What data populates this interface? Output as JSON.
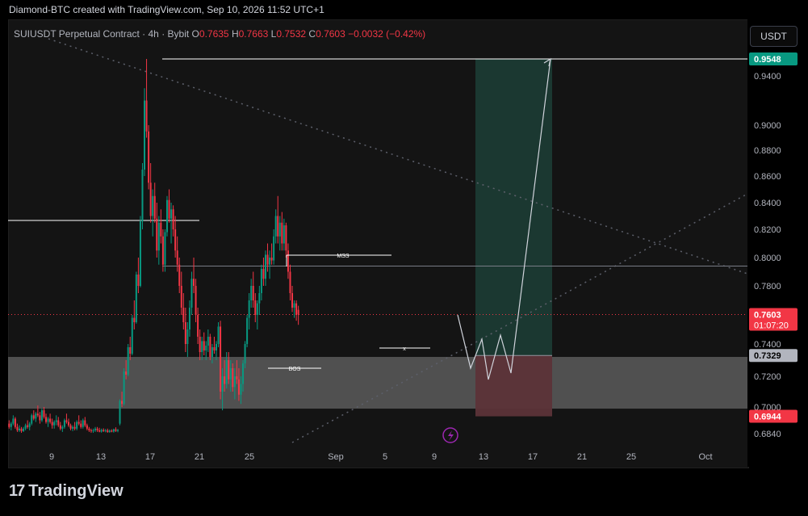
{
  "header": {
    "text": "Diamond-BTC created with TradingView.com, Sep 10, 2026 11:52 UTC+1"
  },
  "legend": {
    "symbol": "SUIUSDT Perpetual Contract · 4h · Bybit",
    "o_label": "O",
    "o": "0.7635",
    "h_label": "H",
    "h": "0.7663",
    "l_label": "L",
    "l": "0.7532",
    "c_label": "C",
    "c": "0.7603",
    "change": "−0.0032 (−0.42%)"
  },
  "currency_button": "USDT",
  "brand": {
    "name": "TradingView",
    "logo_mark": "17"
  },
  "chart_data": {
    "type": "candlestick",
    "x_tick_labels": [
      "9",
      "13",
      "17",
      "21",
      "25",
      "Sep",
      "5",
      "9",
      "13",
      "17",
      "21",
      "25",
      "Oct"
    ],
    "y_tick_labels": [
      "0.9400",
      "0.9000",
      "0.8800",
      "0.8600",
      "0.8400",
      "0.8200",
      "0.8000",
      "0.7800",
      "0.7400",
      "0.7200",
      "0.7000",
      "0.6840"
    ],
    "price_tags": [
      {
        "value": "0.9548",
        "color": "#089981",
        "text_color": "#ffffff"
      },
      {
        "value": "0.7603",
        "color": "#f23645",
        "text_color": "#ffffff",
        "countdown": "01:07:20"
      },
      {
        "value": "0.7329",
        "color": "#b2b5be",
        "text_color": "#000000"
      },
      {
        "value": "0.6944",
        "color": "#f23645",
        "text_color": "#ffffff"
      }
    ],
    "annotations": [
      "MSS",
      "BOS",
      "x"
    ],
    "position": {
      "type": "long",
      "target": 0.9548,
      "entry": 0.7329,
      "stop": 0.6944
    },
    "demand_zone": [
      0.699,
      0.732
    ],
    "resistance_levels": [
      0.9548,
      0.794
    ],
    "colors": {
      "up": "#089981",
      "down": "#f23645",
      "profit_zone": "#1b3a33",
      "loss_zone": "#5c3338",
      "demand_zone": "#5a5a5a"
    },
    "candles": [
      [
        0.69,
        0.692,
        0.687,
        0.688
      ],
      [
        0.688,
        0.691,
        0.686,
        0.69
      ],
      [
        0.69,
        0.695,
        0.689,
        0.693
      ],
      [
        0.693,
        0.694,
        0.687,
        0.688
      ],
      [
        0.688,
        0.69,
        0.685,
        0.686
      ],
      [
        0.686,
        0.689,
        0.685,
        0.687
      ],
      [
        0.687,
        0.688,
        0.6845,
        0.6855
      ],
      [
        0.6855,
        0.688,
        0.685,
        0.687
      ],
      [
        0.687,
        0.69,
        0.686,
        0.689
      ],
      [
        0.689,
        0.692,
        0.687,
        0.688
      ],
      [
        0.688,
        0.691,
        0.686,
        0.69
      ],
      [
        0.69,
        0.696,
        0.689,
        0.695
      ],
      [
        0.695,
        0.698,
        0.692,
        0.693
      ],
      [
        0.693,
        0.697,
        0.691,
        0.696
      ],
      [
        0.696,
        0.701,
        0.694,
        0.695
      ],
      [
        0.695,
        0.697,
        0.69,
        0.692
      ],
      [
        0.692,
        0.699,
        0.691,
        0.698
      ],
      [
        0.698,
        0.7,
        0.693,
        0.694
      ],
      [
        0.694,
        0.696,
        0.69,
        0.691
      ],
      [
        0.691,
        0.694,
        0.688,
        0.693
      ],
      [
        0.693,
        0.696,
        0.69,
        0.691
      ],
      [
        0.691,
        0.693,
        0.687,
        0.689
      ],
      [
        0.689,
        0.692,
        0.687,
        0.691
      ],
      [
        0.691,
        0.695,
        0.689,
        0.692
      ],
      [
        0.692,
        0.694,
        0.688,
        0.689
      ],
      [
        0.689,
        0.691,
        0.686,
        0.687
      ],
      [
        0.687,
        0.689,
        0.685,
        0.688
      ],
      [
        0.688,
        0.693,
        0.687,
        0.692
      ],
      [
        0.692,
        0.696,
        0.69,
        0.691
      ],
      [
        0.691,
        0.693,
        0.688,
        0.689
      ],
      [
        0.689,
        0.69,
        0.686,
        0.687
      ],
      [
        0.687,
        0.689,
        0.6855,
        0.688
      ],
      [
        0.688,
        0.691,
        0.686,
        0.687
      ],
      [
        0.687,
        0.692,
        0.686,
        0.691
      ],
      [
        0.691,
        0.695,
        0.689,
        0.69
      ],
      [
        0.69,
        0.692,
        0.687,
        0.688
      ],
      [
        0.688,
        0.693,
        0.687,
        0.692
      ],
      [
        0.692,
        0.694,
        0.688,
        0.689
      ],
      [
        0.689,
        0.69,
        0.686,
        0.687
      ],
      [
        0.687,
        0.688,
        0.685,
        0.686
      ],
      [
        0.686,
        0.687,
        0.6845,
        0.6855
      ],
      [
        0.6855,
        0.687,
        0.6845,
        0.686
      ],
      [
        0.686,
        0.688,
        0.685,
        0.687
      ],
      [
        0.687,
        0.688,
        0.685,
        0.686
      ],
      [
        0.686,
        0.6875,
        0.6848,
        0.6852
      ],
      [
        0.6852,
        0.687,
        0.6846,
        0.6862
      ],
      [
        0.6862,
        0.6872,
        0.685,
        0.6855
      ],
      [
        0.6855,
        0.6868,
        0.6848,
        0.686
      ],
      [
        0.686,
        0.687,
        0.6845,
        0.685
      ],
      [
        0.685,
        0.6865,
        0.6845,
        0.6858
      ],
      [
        0.6858,
        0.6866,
        0.6848,
        0.6852
      ],
      [
        0.6852,
        0.687,
        0.6846,
        0.6866
      ],
      [
        0.6866,
        0.6878,
        0.685,
        0.6856
      ],
      [
        0.6856,
        0.6868,
        0.6848,
        0.6862
      ],
      [
        0.69,
        0.705,
        0.689,
        0.704
      ],
      [
        0.704,
        0.71,
        0.7,
        0.702
      ],
      [
        0.702,
        0.725,
        0.701,
        0.723
      ],
      [
        0.723,
        0.73,
        0.718,
        0.721
      ],
      [
        0.721,
        0.74,
        0.72,
        0.738
      ],
      [
        0.738,
        0.745,
        0.73,
        0.734
      ],
      [
        0.734,
        0.76,
        0.733,
        0.758
      ],
      [
        0.758,
        0.77,
        0.75,
        0.755
      ],
      [
        0.755,
        0.79,
        0.754,
        0.788
      ],
      [
        0.788,
        0.8,
        0.775,
        0.78
      ],
      [
        0.78,
        0.83,
        0.779,
        0.826
      ],
      [
        0.826,
        0.87,
        0.82,
        0.865
      ],
      [
        0.865,
        0.93,
        0.86,
        0.92
      ],
      [
        0.92,
        0.9548,
        0.89,
        0.895
      ],
      [
        0.895,
        0.9,
        0.85,
        0.855
      ],
      [
        0.855,
        0.87,
        0.825,
        0.83
      ],
      [
        0.83,
        0.85,
        0.815,
        0.845
      ],
      [
        0.845,
        0.855,
        0.825,
        0.828
      ],
      [
        0.828,
        0.84,
        0.8,
        0.805
      ],
      [
        0.805,
        0.83,
        0.795,
        0.825
      ],
      [
        0.825,
        0.835,
        0.81,
        0.815
      ],
      [
        0.815,
        0.82,
        0.79,
        0.795
      ],
      [
        0.795,
        0.82,
        0.79,
        0.818
      ],
      [
        0.818,
        0.845,
        0.815,
        0.842
      ],
      [
        0.842,
        0.85,
        0.825,
        0.828
      ],
      [
        0.828,
        0.84,
        0.81,
        0.835
      ],
      [
        0.835,
        0.838,
        0.815,
        0.82
      ],
      [
        0.82,
        0.83,
        0.8,
        0.805
      ],
      [
        0.805,
        0.815,
        0.79,
        0.795
      ],
      [
        0.795,
        0.8,
        0.775,
        0.78
      ],
      [
        0.78,
        0.79,
        0.76,
        0.765
      ],
      [
        0.765,
        0.775,
        0.75,
        0.755
      ],
      [
        0.755,
        0.765,
        0.735,
        0.74
      ],
      [
        0.74,
        0.755,
        0.732,
        0.75
      ],
      [
        0.75,
        0.77,
        0.745,
        0.765
      ],
      [
        0.765,
        0.79,
        0.76,
        0.785
      ],
      [
        0.785,
        0.8,
        0.775,
        0.78
      ],
      [
        0.78,
        0.785,
        0.755,
        0.76
      ],
      [
        0.76,
        0.765,
        0.74,
        0.745
      ],
      [
        0.745,
        0.75,
        0.73,
        0.735
      ],
      [
        0.735,
        0.745,
        0.73,
        0.742
      ],
      [
        0.742,
        0.748,
        0.733,
        0.736
      ],
      [
        0.736,
        0.742,
        0.73,
        0.739
      ],
      [
        0.739,
        0.75,
        0.735,
        0.745
      ],
      [
        0.745,
        0.747,
        0.73,
        0.732
      ],
      [
        0.732,
        0.74,
        0.728,
        0.738
      ],
      [
        0.738,
        0.745,
        0.734,
        0.736
      ],
      [
        0.736,
        0.742,
        0.73,
        0.74
      ],
      [
        0.74,
        0.755,
        0.738,
        0.752
      ],
      [
        0.752,
        0.756,
        0.705,
        0.71
      ],
      [
        0.71,
        0.725,
        0.698,
        0.72
      ],
      [
        0.72,
        0.73,
        0.71,
        0.715
      ],
      [
        0.715,
        0.735,
        0.712,
        0.73
      ],
      [
        0.73,
        0.735,
        0.715,
        0.718
      ],
      [
        0.718,
        0.73,
        0.71,
        0.725
      ],
      [
        0.725,
        0.728,
        0.71,
        0.713
      ],
      [
        0.713,
        0.725,
        0.705,
        0.72
      ],
      [
        0.72,
        0.73,
        0.715,
        0.718
      ],
      [
        0.718,
        0.725,
        0.704,
        0.708
      ],
      [
        0.708,
        0.72,
        0.702,
        0.715
      ],
      [
        0.715,
        0.73,
        0.71,
        0.728
      ],
      [
        0.728,
        0.742,
        0.725,
        0.74
      ],
      [
        0.74,
        0.76,
        0.738,
        0.758
      ],
      [
        0.758,
        0.775,
        0.75,
        0.77
      ],
      [
        0.77,
        0.785,
        0.765,
        0.78
      ],
      [
        0.78,
        0.79,
        0.765,
        0.77
      ],
      [
        0.77,
        0.775,
        0.755,
        0.76
      ],
      [
        0.76,
        0.77,
        0.75,
        0.768
      ],
      [
        0.768,
        0.78,
        0.76,
        0.775
      ],
      [
        0.775,
        0.795,
        0.77,
        0.792
      ],
      [
        0.792,
        0.8,
        0.78,
        0.785
      ],
      [
        0.785,
        0.805,
        0.78,
        0.802
      ],
      [
        0.802,
        0.81,
        0.79,
        0.795
      ],
      [
        0.795,
        0.805,
        0.785,
        0.8
      ],
      [
        0.8,
        0.81,
        0.795,
        0.798
      ],
      [
        0.798,
        0.82,
        0.795,
        0.815
      ],
      [
        0.815,
        0.835,
        0.81,
        0.83
      ],
      [
        0.83,
        0.845,
        0.81,
        0.815
      ],
      [
        0.815,
        0.83,
        0.805,
        0.825
      ],
      [
        0.825,
        0.833,
        0.805,
        0.81
      ],
      [
        0.81,
        0.828,
        0.805,
        0.823
      ],
      [
        0.823,
        0.825,
        0.8,
        0.805
      ],
      [
        0.805,
        0.81,
        0.785,
        0.79
      ],
      [
        0.79,
        0.795,
        0.77,
        0.775
      ],
      [
        0.775,
        0.78,
        0.762,
        0.765
      ],
      [
        0.765,
        0.77,
        0.758,
        0.768
      ],
      [
        0.768,
        0.77,
        0.756,
        0.76
      ],
      [
        0.7635,
        0.7663,
        0.7532,
        0.7603
      ]
    ]
  }
}
